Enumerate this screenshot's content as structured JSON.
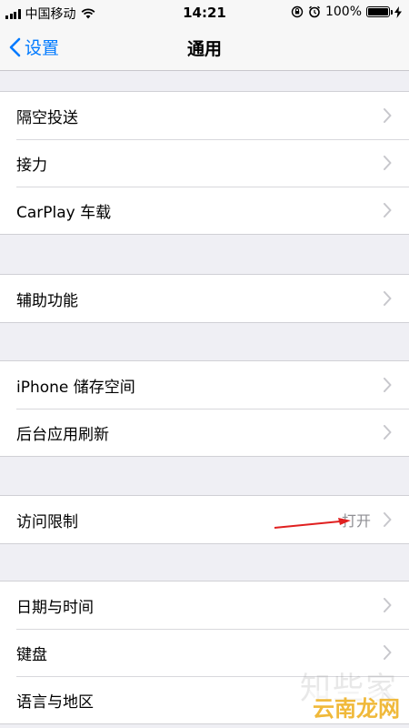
{
  "status_bar": {
    "carrier": "中国移动",
    "time": "14:21",
    "battery": "100%",
    "battery_level": 1.0,
    "icons": [
      "signal-icon",
      "wifi-icon",
      "rotation-lock-icon",
      "alarm-icon",
      "battery-icon",
      "charging-icon"
    ]
  },
  "nav": {
    "back_label": "设置",
    "title": "通用"
  },
  "sections": [
    {
      "rows": [
        {
          "label": "隔空投送"
        },
        {
          "label": "接力"
        },
        {
          "label": "CarPlay 车载"
        }
      ]
    },
    {
      "rows": [
        {
          "label": "辅助功能"
        }
      ]
    },
    {
      "rows": [
        {
          "label": "iPhone 储存空间"
        },
        {
          "label": "后台应用刷新"
        }
      ]
    },
    {
      "rows": [
        {
          "label": "访问限制",
          "detail": "打开"
        }
      ]
    },
    {
      "rows": [
        {
          "label": "日期与时间"
        },
        {
          "label": "键盘"
        },
        {
          "label": "语言与地区"
        }
      ]
    }
  ],
  "annotation": {
    "color": "#e02020"
  },
  "watermark": {
    "text": "云南龙网",
    "faint": "知些家"
  },
  "colors": {
    "accent": "#007aff",
    "background": "#efeff4",
    "chevron": "#c7c7cc"
  }
}
